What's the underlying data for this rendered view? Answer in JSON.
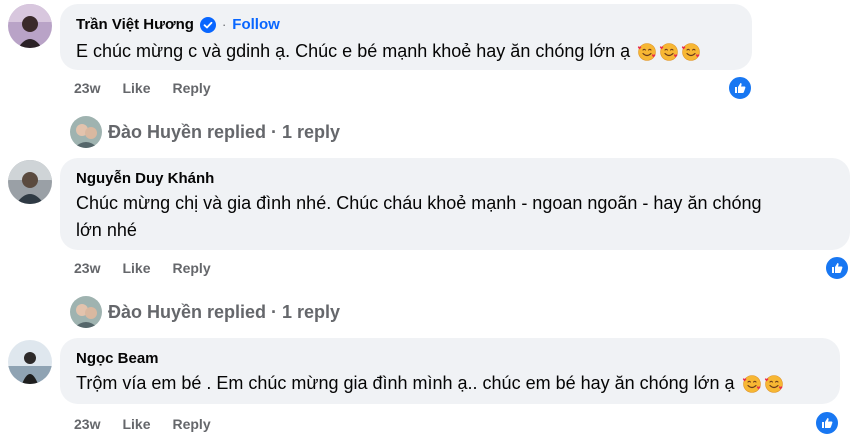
{
  "comments": [
    {
      "author": "Trần Việt Hương",
      "verified": true,
      "follow_label": "Follow",
      "dot": "·",
      "text": "E chúc mừng c và gdinh ạ. Chúc e bé mạnh khoẻ hay ăn chóng lớn ạ",
      "emoji_count": 3,
      "time": "23w",
      "like_label": "Like",
      "reply_label": "Reply"
    },
    {
      "author": "Nguyễn Duy Khánh",
      "text_line1": "Chúc mừng chị và gia đình nhé. Chúc cháu khoẻ mạnh - ngoan ngoãn - hay ăn chóng",
      "text_line2": "lớn nhé",
      "time": "23w",
      "like_label": "Like",
      "reply_label": "Reply"
    },
    {
      "author": "Ngọc Beam",
      "text": "Trộm vía em bé . Em chúc mừng gia đình mình ạ.. chúc em bé hay ăn chóng lớn ạ",
      "emoji_count": 2,
      "time": "23w",
      "like_label": "Like",
      "reply_label": "Reply"
    }
  ],
  "replies": [
    {
      "label": "Đào Huyền replied · 1 reply"
    },
    {
      "label": "Đào Huyền replied · 1 reply"
    }
  ],
  "colors": {
    "bubble": "#f0f2f5",
    "link": "#0866ff",
    "like_badge": "#1877f2",
    "secondary_text": "#65676b"
  },
  "icons": {
    "verified": "verified-badge-icon",
    "emoji": "smiling-face-with-hearts-icon",
    "like": "thumbs-up-icon"
  }
}
